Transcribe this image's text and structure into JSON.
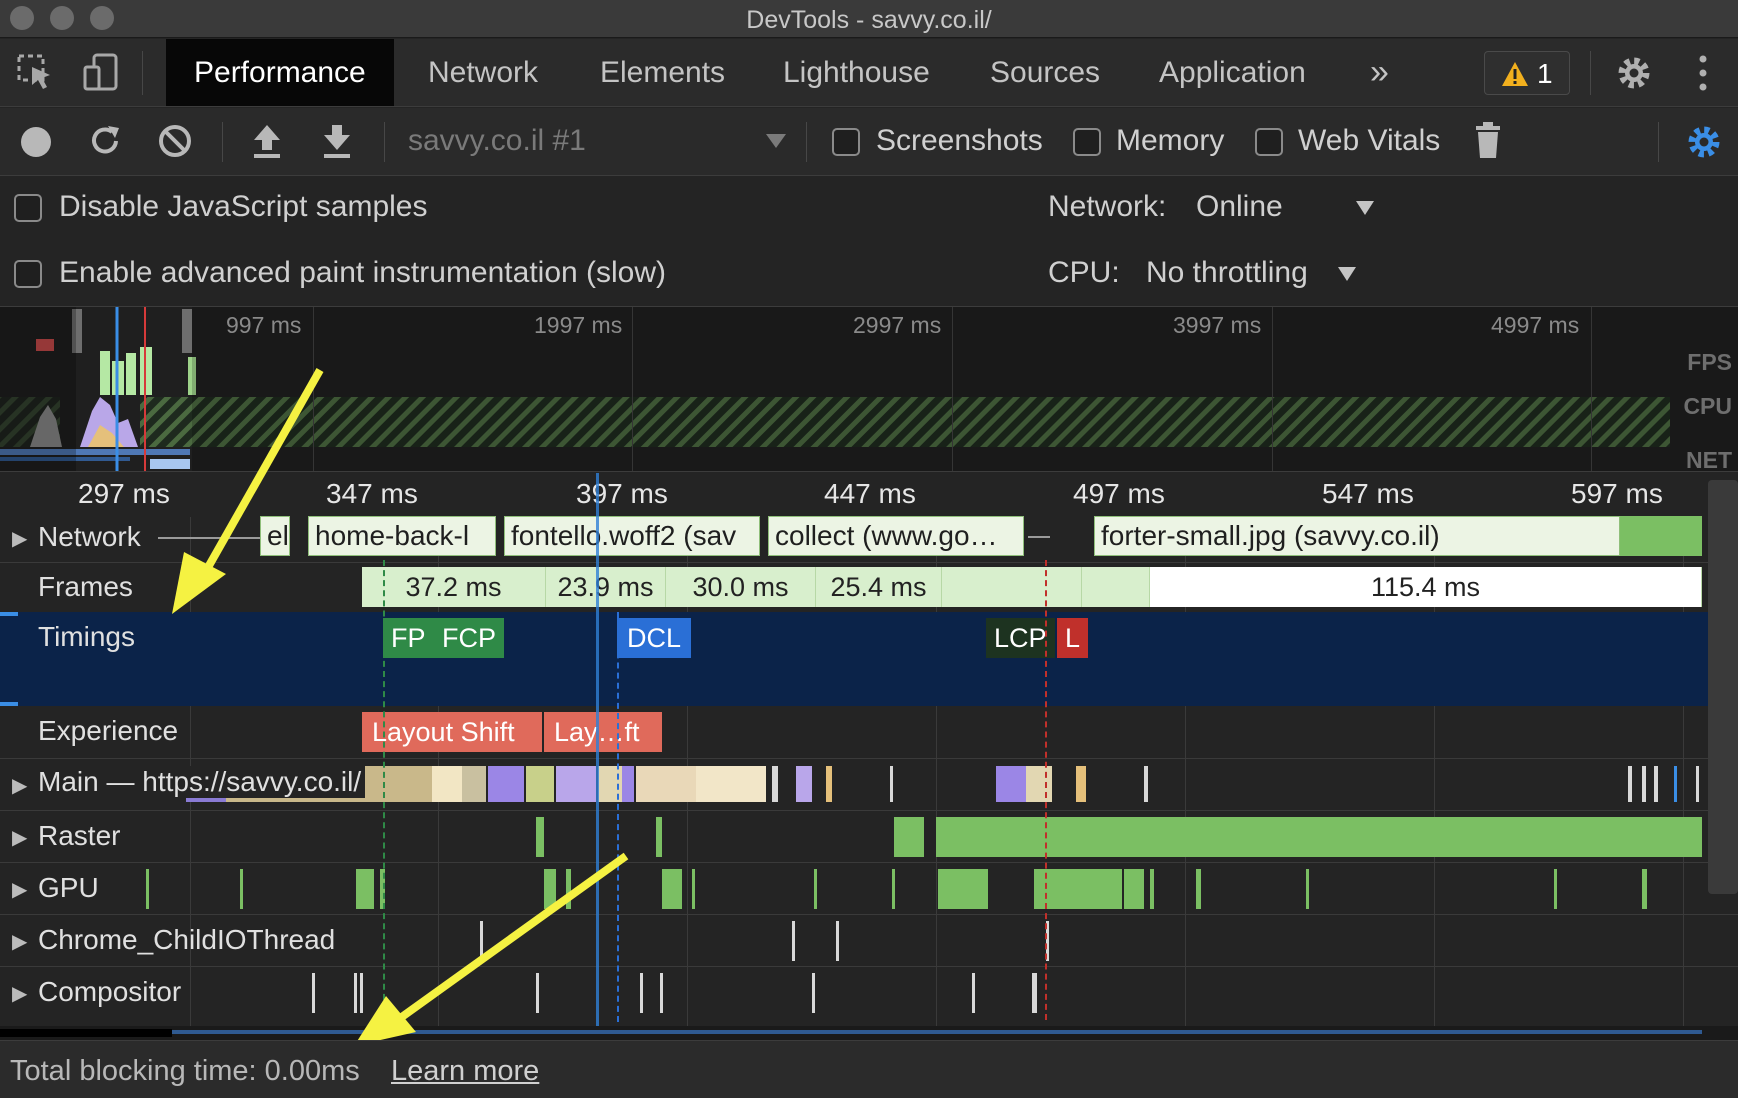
{
  "window": {
    "title": "DevTools - savvy.co.il/"
  },
  "tabs": [
    "Performance",
    "Network",
    "Elements",
    "Lighthouse",
    "Sources",
    "Application"
  ],
  "more_tabs": "»",
  "warnings": {
    "count": "1"
  },
  "toolbar": {
    "profile": "savvy.co.il #1",
    "screenshots": "Screenshots",
    "memory": "Memory",
    "web_vitals": "Web Vitals"
  },
  "settings": {
    "disable_js": "Disable JavaScript samples",
    "advanced_paint": "Enable advanced paint instrumentation (slow)",
    "network_label": "Network:",
    "network_value": "Online",
    "cpu_label": "CPU:",
    "cpu_value": "No throttling"
  },
  "overview": {
    "ticks": [
      "997 ms",
      "1997 ms",
      "2997 ms",
      "3997 ms",
      "4997 ms"
    ],
    "fps": "FPS",
    "cpu": "CPU",
    "net": "NET"
  },
  "ruler": [
    "297 ms",
    "347 ms",
    "397 ms",
    "447 ms",
    "497 ms",
    "547 ms",
    "597 ms"
  ],
  "tracks": {
    "network": "Network",
    "frames": "Frames",
    "timings": "Timings",
    "experience": "Experience",
    "main": "Main — https://savvy.co.il/",
    "raster": "Raster",
    "gpu": "GPU",
    "childio": "Chrome_ChildIOThread",
    "compositor": "Compositor"
  },
  "network_requests": [
    "el",
    "home-back-l",
    "fontello.woff2 (sav",
    "collect (www.go…",
    "forter-small.jpg (savvy.co.il)"
  ],
  "frames": [
    "37.2 ms",
    "23.9 ms",
    "30.0 ms",
    "25.4 ms",
    "115.4 ms"
  ],
  "timings": {
    "fp": "FP",
    "fcp": "FCP",
    "dcl": "DCL",
    "lcp": "LCP",
    "l": "L"
  },
  "experience": [
    "Layout Shift",
    "Lay…ft"
  ],
  "footer": {
    "text": "Total blocking time: 0.00ms",
    "link": "Learn more"
  },
  "colors": {
    "annotation_arrow": "#f5f242",
    "timings_bg": "#0b2349",
    "accent": "#3a8ee6"
  }
}
